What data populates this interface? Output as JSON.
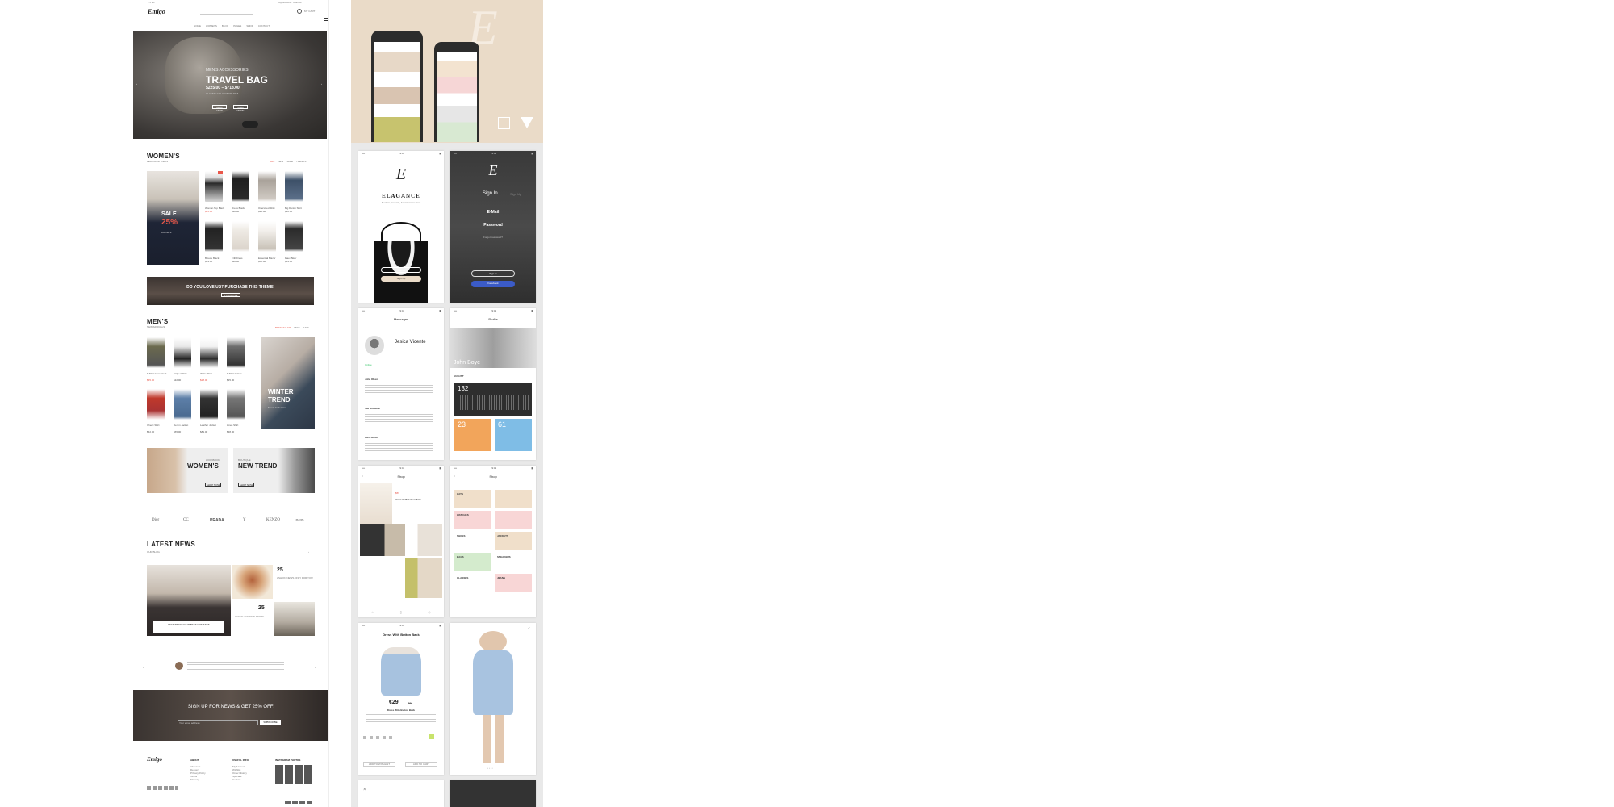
{
  "colors": {
    "accent": "#e9574a",
    "beige": "#eadbc8",
    "dark": "#2b2b2b",
    "facebook": "#3b5bc7",
    "blue_tile": "#7fbde6",
    "orange_tile": "#f2a55b"
  },
  "site": {
    "logo": "Emigo",
    "nav": [
      "HOME",
      "WOMENS",
      "BLOG",
      "PAGES",
      "SHOP",
      "CONTACT"
    ],
    "hero": {
      "subtitle": "MEN'S ACCESSORIES",
      "title": "TRAVEL BAG",
      "price": "$225.00 – $718.00",
      "tagline": "CLASSIC COLLECTION 2016",
      "btn1": "SHOP NOW",
      "btn2": "VIEW MORE"
    },
    "women": {
      "title": "WOMEN'S",
      "subtitle": "FEATURED ITEMS",
      "tabs": [
        "ALL",
        "NEW",
        "SALE",
        "TRENDS"
      ],
      "promo_sale": "SALE",
      "promo_pct": "25%",
      "promo_caption": "Women's",
      "products": [
        {
          "name": "Woman Top Black",
          "price": "$45.00"
        },
        {
          "name": "Dress Black",
          "price": "$38.00"
        },
        {
          "name": "Oversized Shirt",
          "price": "$36.00"
        },
        {
          "name": "Big Denim Shirt",
          "price": "$32.00"
        },
        {
          "name": "Blouse Black",
          "price": "$29.00"
        },
        {
          "name": "Frill Dress",
          "price": "$28.00"
        },
        {
          "name": "Essential Blazer",
          "price": "$58.00"
        },
        {
          "name": "Faux Biker",
          "price": "$44.00"
        }
      ]
    },
    "banner": {
      "text": "DO YOU LOVE US? PURCHASE THIS THEME!",
      "btn": "PURCHASE"
    },
    "men": {
      "title": "MEN'S",
      "subtitle": "NEW ARRIVALS",
      "tabs": [
        "BESTSELLER",
        "NEW",
        "SALE"
      ],
      "promo_title1": "WINTER",
      "promo_title2": "TREND",
      "promo_caption": "Men's Collection",
      "products": [
        {
          "name": "T-Shirt Crew Neck",
          "price": "$35.00"
        },
        {
          "name": "Striped Shirt",
          "price": "$32.00"
        },
        {
          "name": "White Shirt",
          "price": "$28.00"
        },
        {
          "name": "T-Shirt Cotton",
          "price": "$25.00"
        },
        {
          "name": "Check Shirt",
          "price": "$42.00"
        },
        {
          "name": "Denim Jacket",
          "price": "$55.00"
        },
        {
          "name": "Leather Jacket",
          "price": "$89.00"
        },
        {
          "name": "Linen Shirt",
          "price": "$38.00"
        }
      ]
    },
    "cat_banners": [
      {
        "pre": "LOOKBOOK",
        "title": "WOMEN'S",
        "btn": "SHOP NOW"
      },
      {
        "pre": "BOUTIQUE",
        "title": "NEW TREND",
        "btn": "SHOP NOW"
      }
    ],
    "brands": [
      "Dior",
      "CC",
      "PRADA",
      "Y",
      "KENZO",
      "CHANEL"
    ],
    "news": {
      "title": "LATEST NEWS",
      "subtitle": "OUR BLOG",
      "day1": "25",
      "day2": "25",
      "post1": "ASHION NEWS ONLY FOR YOU",
      "post2": "CHECK THE NEW STORE",
      "post_main": "REMEMBER YOUR BEST MOMENTS"
    },
    "newsletter": {
      "title": "SIGN UP FOR NEWS & GET 25% OFF!",
      "placeholder": "Your email address",
      "btn": "SUBSCRIBE"
    },
    "footer": {
      "cols": [
        "ABOUT",
        "USEFUL INFO",
        "INSTAGRAM PHOTOS"
      ],
      "about_links": [
        "About Us",
        "Delivery",
        "Privacy Policy",
        "Terms",
        "Sitemap"
      ],
      "info_links": [
        "My Account",
        "Wishlist",
        "Order History",
        "Specials",
        "Contact"
      ]
    }
  },
  "app": {
    "brand_letter": "E",
    "splash": {
      "title": "ELAGANCE",
      "tagline": "Modern products, best items in store",
      "signin": "Sign In",
      "signup": "Sign Up"
    },
    "login": {
      "tab_signin": "Sign In",
      "tab_signup": "Sign Up",
      "email": "E-Mail",
      "password": "Password",
      "forgot": "Forgot password?",
      "signin_btn": "Sign In",
      "facebook_btn": "Facebook"
    },
    "messages": {
      "title": "Messages",
      "name": "Jesica Vicente",
      "status": "Online",
      "rows": [
        {
          "name": "John Olsco"
        },
        {
          "name": "Juli Simbena"
        },
        {
          "name": "Glen Sonus"
        }
      ]
    },
    "profile": {
      "title": "Profile",
      "name": "John Boye",
      "stat_main": "132",
      "stat_a": "23",
      "stat_b": "61",
      "month": "AUGUST"
    },
    "shop": {
      "title": "Shop",
      "price_tag": "$59",
      "item": "Anna Cuff Cotton Knit"
    },
    "categories": {
      "title": "Shop",
      "tiles": [
        "HATS",
        "WATCHES",
        "SHOES",
        "JACKETS",
        "BAGS",
        "SNEAKERS",
        "GLASSES",
        "JEANS"
      ]
    },
    "product": {
      "title": "Dress With Button Back",
      "price": "€29",
      "old_price": "€43",
      "name": "Dress With Button Back",
      "btn_wishlist": "ADD TO WISHLIST",
      "btn_cart": "ADD TO CART"
    }
  }
}
